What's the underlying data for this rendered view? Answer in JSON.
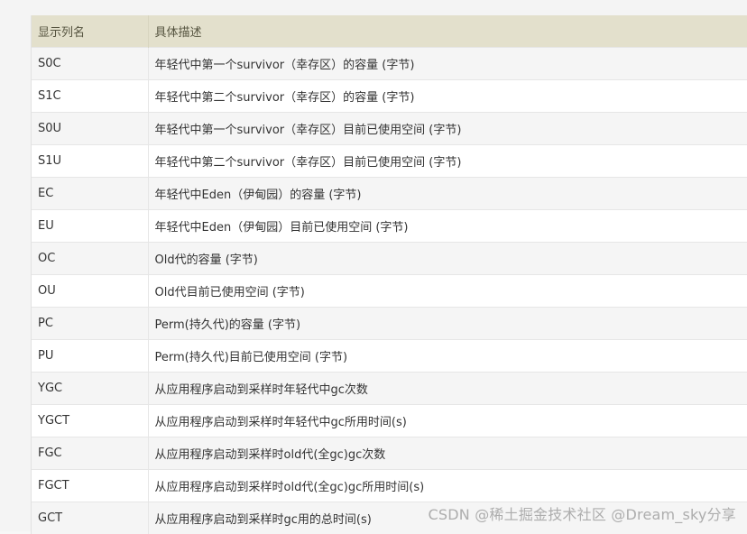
{
  "table": {
    "headers": [
      "显示列名",
      "具体描述"
    ],
    "rows": [
      {
        "name": "S0C",
        "desc": "年轻代中第一个survivor（幸存区）的容量 (字节)"
      },
      {
        "name": "S1C",
        "desc": "年轻代中第二个survivor（幸存区）的容量 (字节)"
      },
      {
        "name": "S0U",
        "desc": "年轻代中第一个survivor（幸存区）目前已使用空间 (字节)"
      },
      {
        "name": "S1U",
        "desc": "年轻代中第二个survivor（幸存区）目前已使用空间 (字节)"
      },
      {
        "name": "EC",
        "desc": "年轻代中Eden（伊甸园）的容量 (字节)"
      },
      {
        "name": "EU",
        "desc": "年轻代中Eden（伊甸园）目前已使用空间 (字节)"
      },
      {
        "name": "OC",
        "desc": "Old代的容量 (字节)"
      },
      {
        "name": "OU",
        "desc": "Old代目前已使用空间 (字节)"
      },
      {
        "name": "PC",
        "desc": "Perm(持久代)的容量 (字节)"
      },
      {
        "name": "PU",
        "desc": "Perm(持久代)目前已使用空间 (字节)"
      },
      {
        "name": "YGC",
        "desc": "从应用程序启动到采样时年轻代中gc次数"
      },
      {
        "name": "YGCT",
        "desc": "从应用程序启动到采样时年轻代中gc所用时间(s)"
      },
      {
        "name": "FGC",
        "desc": "从应用程序启动到采样时old代(全gc)gc次数"
      },
      {
        "name": "FGCT",
        "desc": "从应用程序启动到采样时old代(全gc)gc所用时间(s)"
      },
      {
        "name": "GCT",
        "desc": "从应用程序启动到采样时gc用的总时间(s)"
      }
    ]
  },
  "watermark": "CSDN @稀土掘金技术社区 @Dream_sky分享"
}
